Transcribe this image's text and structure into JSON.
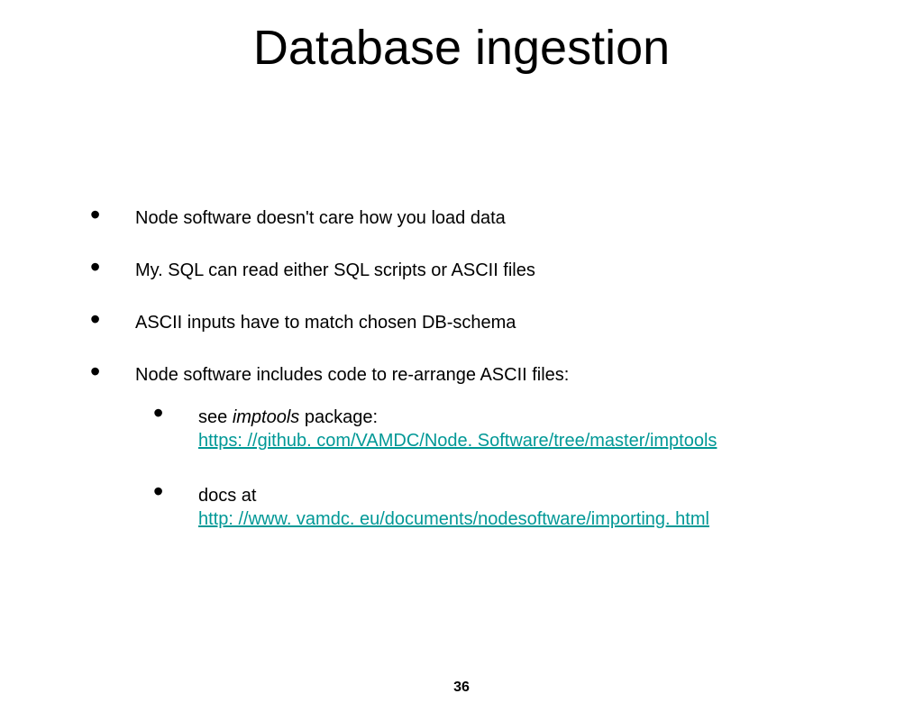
{
  "title": "Database ingestion",
  "bullets": {
    "b0": "Node software doesn't care how you load data",
    "b1": "My. SQL can read either SQL scripts or ASCII files",
    "b2": "ASCII inputs have to match chosen DB-schema",
    "b3": "Node software includes code to re-arrange ASCII files:"
  },
  "sub": {
    "s0_prefix": "see ",
    "s0_italic": "imptools",
    "s0_suffix": " package: ",
    "s0_link": "https: //github. com/VAMDC/Node. Software/tree/master/imptools",
    "s1_prefix": "docs at ",
    "s1_link": "http: //www. vamdc. eu/documents/nodesoftware/importing. html"
  },
  "page_number": "36"
}
